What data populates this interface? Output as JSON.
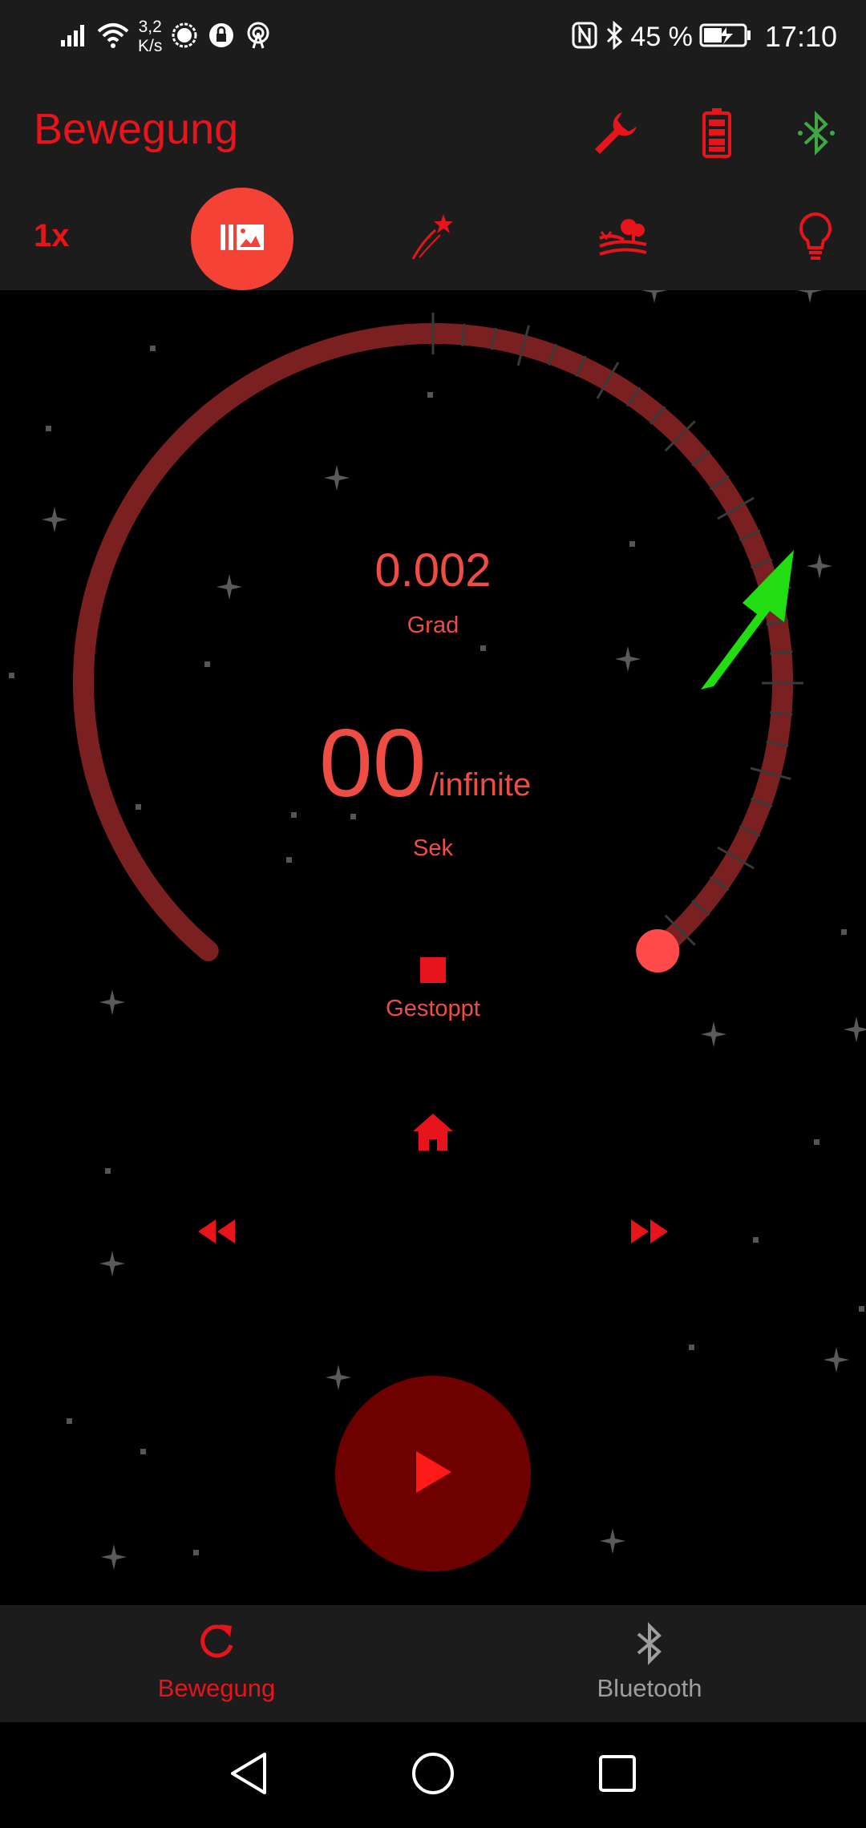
{
  "status_bar": {
    "net_speed_value": "3,2",
    "net_speed_unit": "K/s",
    "battery_percent": "45 %",
    "time": "17:10"
  },
  "app_bar": {
    "title": "Bewegung",
    "speed": "1x",
    "actions": [
      "wrench-icon",
      "battery-icon",
      "bluetooth-icon"
    ],
    "modes": [
      "gallery-mode-icon",
      "shooting-star-icon",
      "landscape-icon",
      "lightbulb-icon"
    ]
  },
  "gauge": {
    "degrees": "0.002",
    "degrees_unit": "Grad",
    "timer_elapsed": "00",
    "timer_total": "/infinite",
    "timer_unit": "Sek",
    "state": "Gestoppt"
  },
  "controls": [
    "home-icon",
    "rewind-icon",
    "fast-forward-icon",
    "play-icon"
  ],
  "bottom_nav": {
    "items": [
      {
        "label": "Bewegung",
        "icon": "refresh-icon",
        "active": true
      },
      {
        "label": "Bluetooth",
        "icon": "bluetooth-icon",
        "active": false
      }
    ]
  },
  "colors": {
    "accent": "#e8141b",
    "accent_soft": "#ef4d44",
    "arc": "#7a2020",
    "play_bg": "#6e0000",
    "bluetooth_green": "#3fa843",
    "annotation_arrow": "#22dd11",
    "bar_bg": "#1c1c1c"
  }
}
